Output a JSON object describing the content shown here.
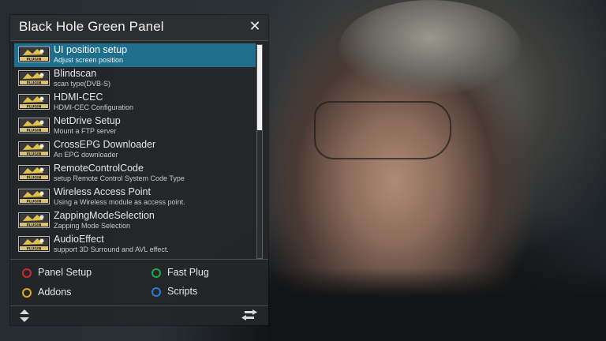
{
  "panel": {
    "title": "Black Hole Green Panel",
    "close_symbol": "✕"
  },
  "plugins": [
    {
      "name": "UI position setup",
      "description": "Adjust screen position",
      "icon": "plugin-icon",
      "selected": true
    },
    {
      "name": "Blindscan",
      "description": "scan type(DVB-S)",
      "icon": "plugin-icon",
      "selected": false
    },
    {
      "name": "HDMI-CEC",
      "description": "HDMI-CEC Configuration",
      "icon": "plugin-icon",
      "selected": false
    },
    {
      "name": "NetDrive Setup",
      "description": "Mount a FTP server",
      "icon": "plugin-icon",
      "selected": false
    },
    {
      "name": "CrossEPG Downloader",
      "description": "An EPG downloader",
      "icon": "plugin-icon",
      "selected": false
    },
    {
      "name": "RemoteControlCode",
      "description": "setup Remote Control System Code Type",
      "icon": "plugin-icon",
      "selected": false
    },
    {
      "name": "Wireless Access Point",
      "description": "Using a Wireless module as access point.",
      "icon": "plugin-icon",
      "selected": false
    },
    {
      "name": "ZappingModeSelection",
      "description": "Zapping Mode Selection",
      "icon": "plugin-icon",
      "selected": false
    },
    {
      "name": "AudioEffect",
      "description": "support 3D Surround and AVL effect.",
      "icon": "plugin-icon",
      "selected": false
    }
  ],
  "plugin_badge_text": "PLUGIN",
  "color_buttons": {
    "red": {
      "label": "Panel Setup",
      "color": "#d02a2a"
    },
    "green": {
      "label": "Fast Plug",
      "color": "#1fa84a"
    },
    "yellow": {
      "label": "Addons",
      "color": "#e0a81c"
    },
    "blue": {
      "label": "Scripts",
      "color": "#2a7ad8"
    }
  },
  "nav": {
    "updown_icon": "up-down-arrows-icon",
    "swap_icon": "swap-arrows-icon"
  },
  "scroll": {
    "visible_fraction": 0.4
  }
}
